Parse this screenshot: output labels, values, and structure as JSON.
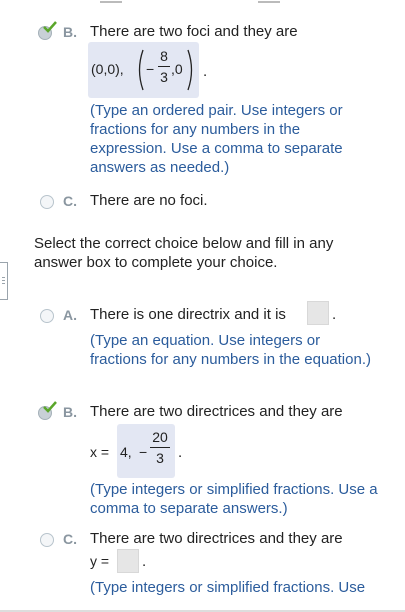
{
  "foci_choices": {
    "B": {
      "letter": "B.",
      "text": "There are two foci and they are",
      "answer_left": "(0,0),",
      "answer_right_numerator": "8",
      "answer_right_denominator": "3",
      "answer_right_sign": "−",
      "answer_right_tail": ",0",
      "period": ".",
      "hint": "(Type an ordered pair. Use integers or fractions for any numbers in the expression. Use a comma to separate answers as needed.)",
      "selected": true
    },
    "C": {
      "letter": "C.",
      "text": "There are no foci.",
      "selected": false
    }
  },
  "directrix_prompt": "Select the correct choice below and fill in any answer box to complete your choice.",
  "directrix_choices": {
    "A": {
      "letter": "A.",
      "text": "There is one directrix and it is",
      "period": ".",
      "hint": "(Type an equation. Use integers or fractions for any numbers in the equation.)",
      "selected": false
    },
    "B": {
      "letter": "B.",
      "text": "There are two directrices and they are",
      "prefix": "x =",
      "first_value": "4,",
      "sign": "−",
      "numerator": "20",
      "denominator": "3",
      "period": ".",
      "hint": "(Type integers or simplified fractions. Use a comma to separate answers.)",
      "selected": true
    },
    "C": {
      "letter": "C.",
      "text": "There are two directrices and they are",
      "prefix": "y =",
      "period": ".",
      "hint_partial": "(Type integers or simplified fractions. Use",
      "selected": false
    }
  }
}
